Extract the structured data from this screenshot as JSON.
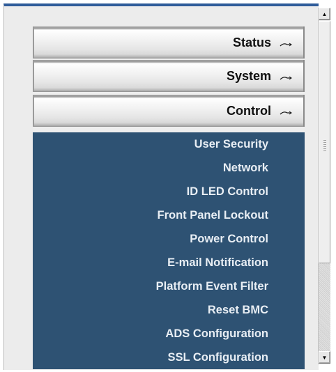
{
  "nav": {
    "sections": [
      {
        "label": "Status"
      },
      {
        "label": "System"
      },
      {
        "label": "Control"
      }
    ],
    "control_items": [
      "User Security",
      "Network",
      "ID LED Control",
      "Front Panel Lockout",
      "Power Control",
      "E-mail Notification",
      "Platform Event Filter",
      "Reset BMC",
      "ADS Configuration",
      "SSL Configuration"
    ]
  },
  "icons": {
    "section_toggle": "collapse-arrow-icon",
    "scroll_up": "scroll-up-arrow-icon",
    "scroll_down": "scroll-down-arrow-icon"
  },
  "colors": {
    "submenu_background": "#2e5273",
    "submenu_text": "#e8eef4",
    "frame_accent": "#2f5c9a"
  }
}
